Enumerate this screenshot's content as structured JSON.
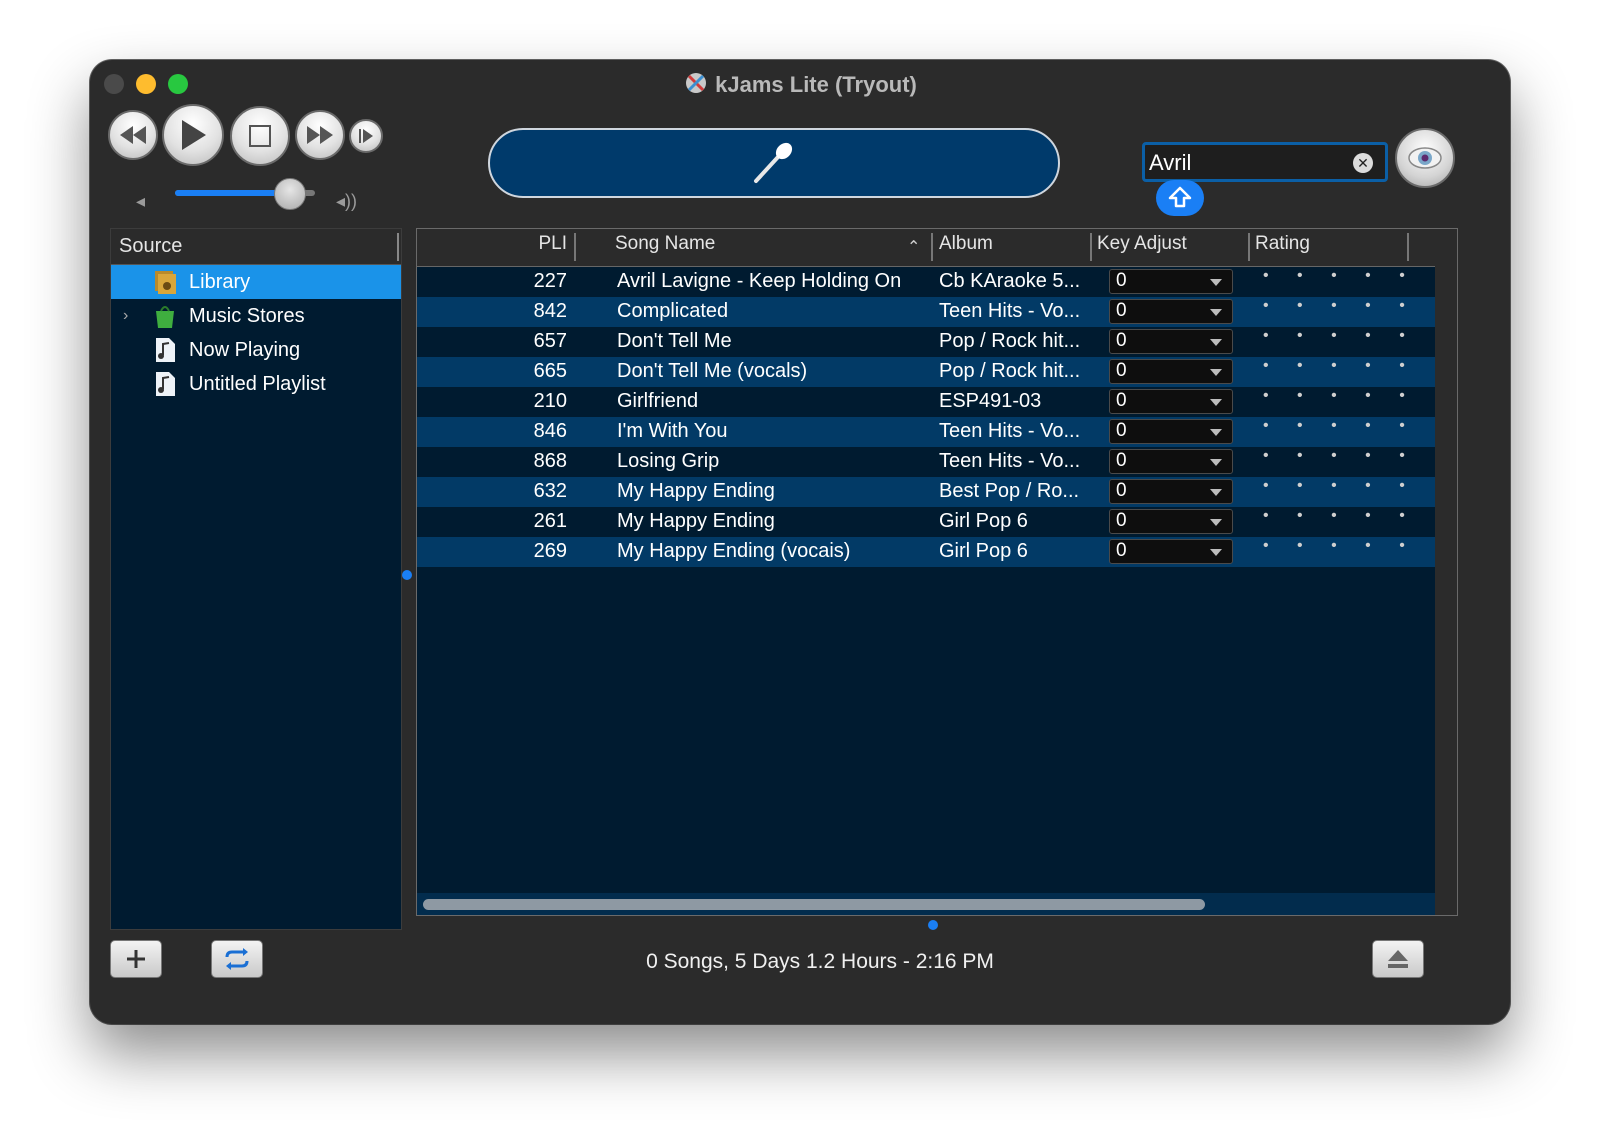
{
  "window": {
    "title": "kJams Lite (Tryout)"
  },
  "search": {
    "value": "Avril"
  },
  "volume": {
    "level": 0.82
  },
  "source": {
    "header": "Source",
    "items": [
      {
        "label": "Library",
        "icon": "library-icon",
        "selected": true,
        "expandable": false
      },
      {
        "label": "Music Stores",
        "icon": "music-store-icon",
        "selected": false,
        "expandable": true
      },
      {
        "label": "Now Playing",
        "icon": "playlist-icon",
        "selected": false,
        "expandable": false
      },
      {
        "label": "Untitled Playlist",
        "icon": "playlist-icon",
        "selected": false,
        "expandable": false
      }
    ]
  },
  "table": {
    "columns": {
      "pli": "PLI",
      "song": "Song Name",
      "album": "Album",
      "key": "Key Adjust",
      "rating": "Rating"
    },
    "rows": [
      {
        "pli": "227",
        "song": "Avril Lavigne - Keep Holding On",
        "album": "Cb KAraoke 5...",
        "key": "0",
        "rating": "• • • • •"
      },
      {
        "pli": "842",
        "song": "Complicated",
        "album": "Teen Hits - Vo...",
        "key": "0",
        "rating": "• • • • •"
      },
      {
        "pli": "657",
        "song": "Don't Tell Me",
        "album": "Pop / Rock hit...",
        "key": "0",
        "rating": "• • • • •"
      },
      {
        "pli": "665",
        "song": "Don't Tell Me (vocals)",
        "album": "Pop / Rock hit...",
        "key": "0",
        "rating": "• • • • •"
      },
      {
        "pli": "210",
        "song": "Girlfriend",
        "album": "ESP491-03",
        "key": "0",
        "rating": "• • • • •"
      },
      {
        "pli": "846",
        "song": "I'm With You",
        "album": "Teen Hits - Vo...",
        "key": "0",
        "rating": "• • • • •"
      },
      {
        "pli": "868",
        "song": "Losing Grip",
        "album": "Teen Hits - Vo...",
        "key": "0",
        "rating": "• • • • •"
      },
      {
        "pli": "632",
        "song": "My Happy Ending",
        "album": "Best Pop / Ro...",
        "key": "0",
        "rating": "• • • • •"
      },
      {
        "pli": "261",
        "song": "My Happy Ending",
        "album": "Girl Pop 6",
        "key": "0",
        "rating": "• • • • •"
      },
      {
        "pli": "269",
        "song": "My Happy Ending (vocais)",
        "album": "Girl Pop 6",
        "key": "0",
        "rating": "• • • • •"
      }
    ]
  },
  "status": {
    "text": "0 Songs, 5 Days 1.2 Hours - 2:16 PM"
  },
  "colors": {
    "accent": "#1a7ff5",
    "selection": "#1a93e9",
    "row_alt": "#023a66",
    "row_base": "#001b30",
    "lcd": "#003a6b"
  }
}
